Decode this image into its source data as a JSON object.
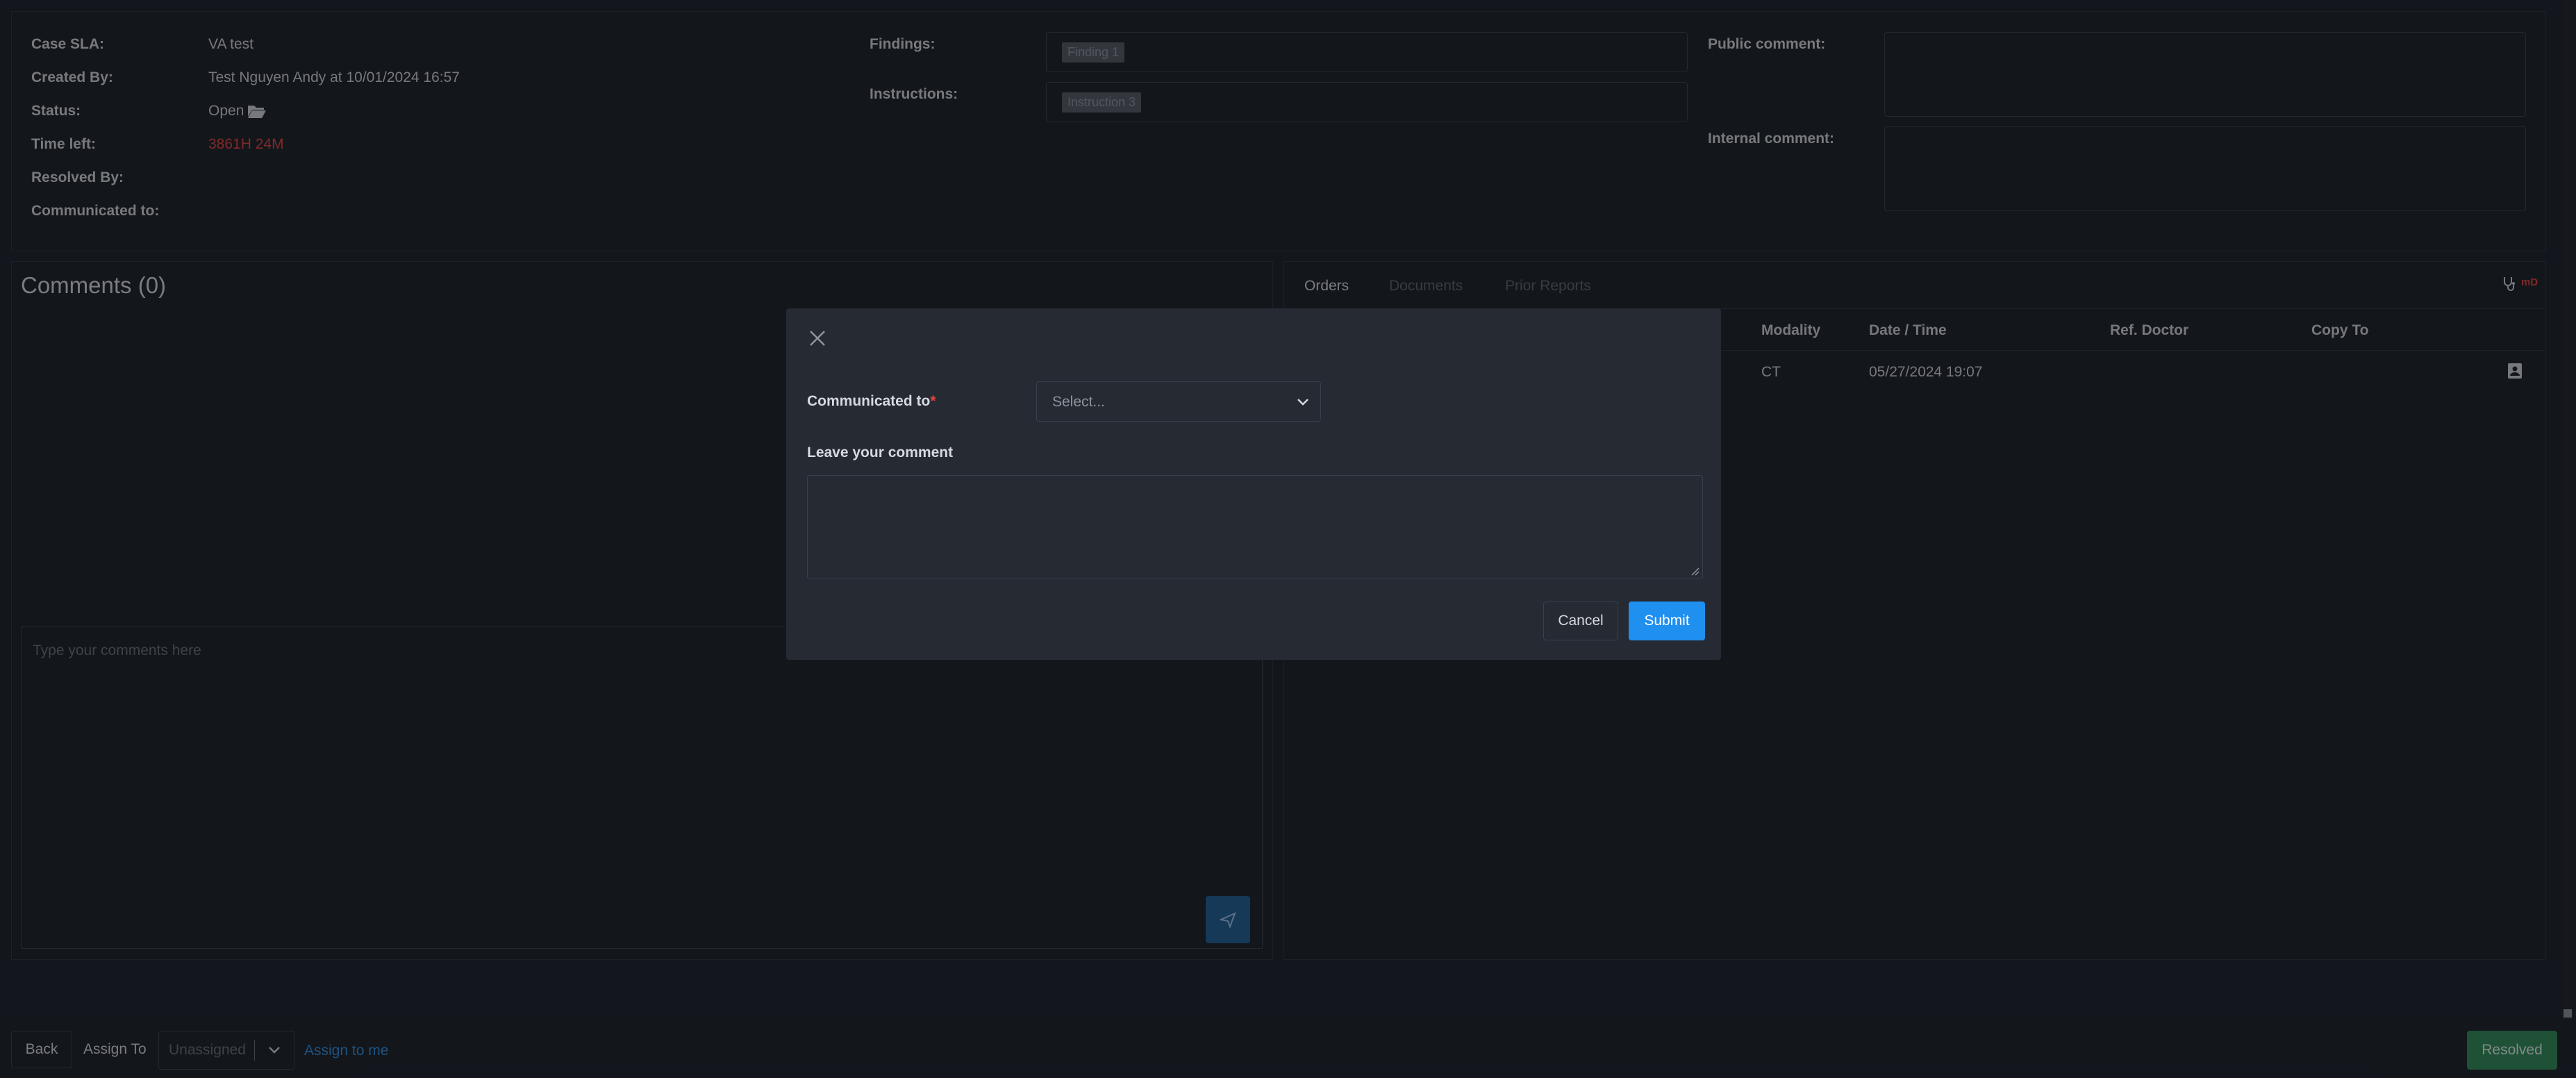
{
  "case_info": {
    "case_sla_label": "Case SLA:",
    "case_sla_value": "VA test",
    "created_by_label": "Created By:",
    "created_by_value": "Test Nguyen Andy at 10/01/2024 16:57",
    "status_label": "Status:",
    "status_value": "Open",
    "time_left_label": "Time left:",
    "time_left_value": "3861H 24M",
    "resolved_by_label": "Resolved By:",
    "communicated_to_label": "Communicated to:"
  },
  "findings": {
    "findings_label": "Findings:",
    "findings_chip": "Finding 1",
    "instructions_label": "Instructions:",
    "instructions_chip": "Instruction 3"
  },
  "comments_fields": {
    "public_label": "Public comment:",
    "internal_label": "Internal comment:"
  },
  "comments_panel": {
    "title": "Comments (0)",
    "input_placeholder": "Type your comments here"
  },
  "orders_panel": {
    "tabs": [
      "Orders",
      "Documents",
      "Prior Reports"
    ],
    "badge": "mD",
    "columns": [
      "Modality",
      "Date / Time",
      "Ref. Doctor",
      "Copy To"
    ],
    "rows": [
      {
        "modality": "CT",
        "datetime": "05/27/2024 19:07",
        "ref_doctor": "",
        "copy_to": ""
      }
    ]
  },
  "modal": {
    "communicated_label": "Communicated to",
    "required_mark": "*",
    "select_placeholder": "Select...",
    "comment_label": "Leave your comment",
    "cancel_label": "Cancel",
    "submit_label": "Submit"
  },
  "footer": {
    "back_label": "Back",
    "assign_to_label": "Assign To",
    "assign_select_value": "Unassigned",
    "assign_to_me_label": "Assign to me",
    "resolved_label": "Resolved"
  },
  "colors": {
    "accent_blue": "#1f8ff0",
    "danger_red": "#e0443e",
    "success_green": "#2e8b57",
    "link_blue": "#2d8fe0"
  }
}
